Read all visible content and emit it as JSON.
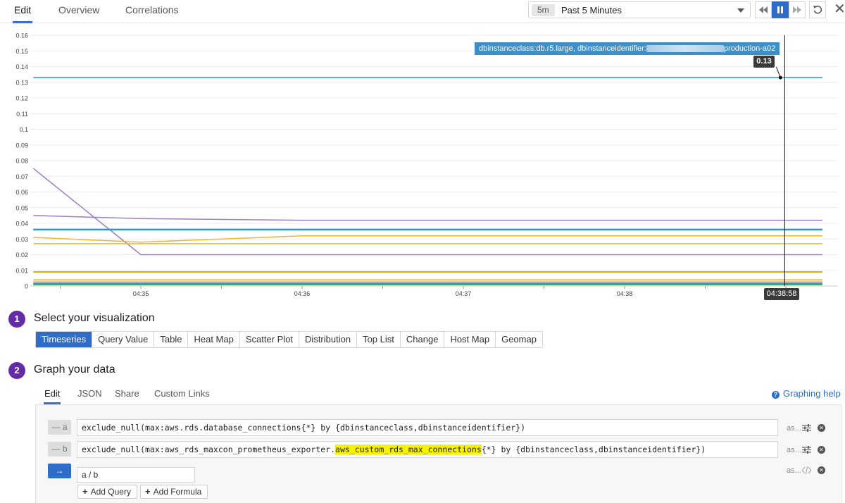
{
  "top_tabs": [
    {
      "label": "Edit",
      "active": true
    },
    {
      "label": "Overview",
      "active": false
    },
    {
      "label": "Correlations",
      "active": false
    }
  ],
  "time_selector": {
    "badge": "5m",
    "label": "Past 5 Minutes"
  },
  "controls": {
    "rewind_icon": "rewind-icon",
    "pause_icon": "pause-icon",
    "forward_icon": "fast-forward-icon",
    "reset_icon": "reset-icon",
    "close_icon": "close-icon",
    "close_glyph": "✕"
  },
  "chart_data": {
    "type": "line",
    "x": [
      "04:34:20",
      "04:35",
      "04:36",
      "04:37",
      "04:38",
      "04:38:58",
      "04:39:15"
    ],
    "x_ticks": [
      "04:35",
      "04:36",
      "04:37",
      "04:38"
    ],
    "y_ticks": [
      "0",
      "0.01",
      "0.02",
      "0.03",
      "0.04",
      "0.05",
      "0.06",
      "0.07",
      "0.08",
      "0.09",
      "0.1",
      "0.11",
      "0.12",
      "0.13",
      "0.14",
      "0.15",
      "0.16"
    ],
    "ylim": [
      0,
      0.16
    ],
    "grid": true,
    "series": [
      {
        "color": "#3d8fc9",
        "width": 1.5,
        "values": [
          0.133,
          0.133,
          0.133,
          0.133,
          0.133,
          0.133,
          0.133
        ]
      },
      {
        "color": "#9b7fc6",
        "width": 1.5,
        "values": [
          0.075,
          0.02,
          0.02,
          0.02,
          0.02,
          0.02,
          0.02
        ]
      },
      {
        "color": "#9b7fc6",
        "width": 1.5,
        "values": [
          0.045,
          0.043,
          0.042,
          0.042,
          0.042,
          0.042,
          0.042
        ]
      },
      {
        "color": "#3d8fc9",
        "width": 2.5,
        "values": [
          0.036,
          0.036,
          0.036,
          0.036,
          0.036,
          0.036,
          0.036
        ]
      },
      {
        "color": "#f2b72d",
        "width": 1.5,
        "values": [
          0.031,
          0.028,
          0.032,
          0.032,
          0.032,
          0.032,
          0.032
        ]
      },
      {
        "color": "#f2b72d",
        "width": 1.5,
        "values": [
          0.027,
          0.027,
          0.027,
          0.027,
          0.027,
          0.027,
          0.027
        ]
      },
      {
        "color": "#e6a613",
        "width": 2,
        "values": [
          0.009,
          0.009,
          0.009,
          0.009,
          0.009,
          0.009,
          0.009
        ]
      },
      {
        "color": "#f2b72d",
        "width": 1.5,
        "values": [
          0.004,
          0.004,
          0.004,
          0.004,
          0.004,
          0.004,
          0.004
        ]
      },
      {
        "color": "#f7c948",
        "width": 1.5,
        "values": [
          0.003,
          0.003,
          0.003,
          0.003,
          0.003,
          0.003,
          0.003
        ]
      },
      {
        "color": "#7b5fb0",
        "width": 1.5,
        "values": [
          0.002,
          0.002,
          0.002,
          0.002,
          0.002,
          0.002,
          0.002
        ]
      },
      {
        "color": "#3d8fc9",
        "width": 1.5,
        "values": [
          0.0015,
          0.0015,
          0.0015,
          0.0015,
          0.0015,
          0.0015,
          0.0015
        ]
      },
      {
        "color": "#4caf50",
        "width": 1.5,
        "values": [
          0.0008,
          0.0008,
          0.0008,
          0.0008,
          0.0008,
          0.0008,
          0.0008
        ]
      }
    ],
    "tooltip": {
      "series_prefix": "dbinstanceclass:db.r5.large, dbinstanceidentifier:",
      "series_suffix": "production-a02",
      "value": "0.13",
      "time": "04:38:58",
      "x": "04:38:58",
      "y": 0.133
    }
  },
  "steps": [
    {
      "number": "1",
      "title": "Select your visualization"
    },
    {
      "number": "2",
      "title": "Graph your data"
    }
  ],
  "visualizations": [
    {
      "label": "Timeseries",
      "active": true
    },
    {
      "label": "Query Value",
      "active": false
    },
    {
      "label": "Table",
      "active": false
    },
    {
      "label": "Heat Map",
      "active": false
    },
    {
      "label": "Scatter Plot",
      "active": false
    },
    {
      "label": "Distribution",
      "active": false
    },
    {
      "label": "Top List",
      "active": false
    },
    {
      "label": "Change",
      "active": false
    },
    {
      "label": "Host Map",
      "active": false
    },
    {
      "label": "Geomap",
      "active": false
    }
  ],
  "graph_tabs": [
    {
      "label": "Edit",
      "active": true
    },
    {
      "label": "JSON",
      "active": false
    },
    {
      "label": "Share",
      "active": false
    },
    {
      "label": "Custom Links",
      "active": false
    }
  ],
  "graphing_help": "Graphing help",
  "queries": [
    {
      "letter": "— a",
      "text_before": "exclude_null(max:aws.rds.database_connections{*} by {dbinstanceclass,dbinstanceidentifier})",
      "highlight": "",
      "text_after": "",
      "as_label": "as..."
    },
    {
      "letter": "— b",
      "text_before": "exclude_null(max:aws_rds_maxcon_prometheus_exporter.",
      "highlight": "aws_custom_rds_max_connections",
      "text_after": "{*} by {dbinstanceclass,dbinstanceidentifier})",
      "as_label": "as..."
    }
  ],
  "formula": {
    "arrow": "→",
    "text": "a / b",
    "as_label": "as..."
  },
  "add_query_label": "Add Query",
  "add_formula_label": "Add Formula",
  "remove_glyph": "✕",
  "plus_glyph": "+",
  "help_glyph": "?"
}
